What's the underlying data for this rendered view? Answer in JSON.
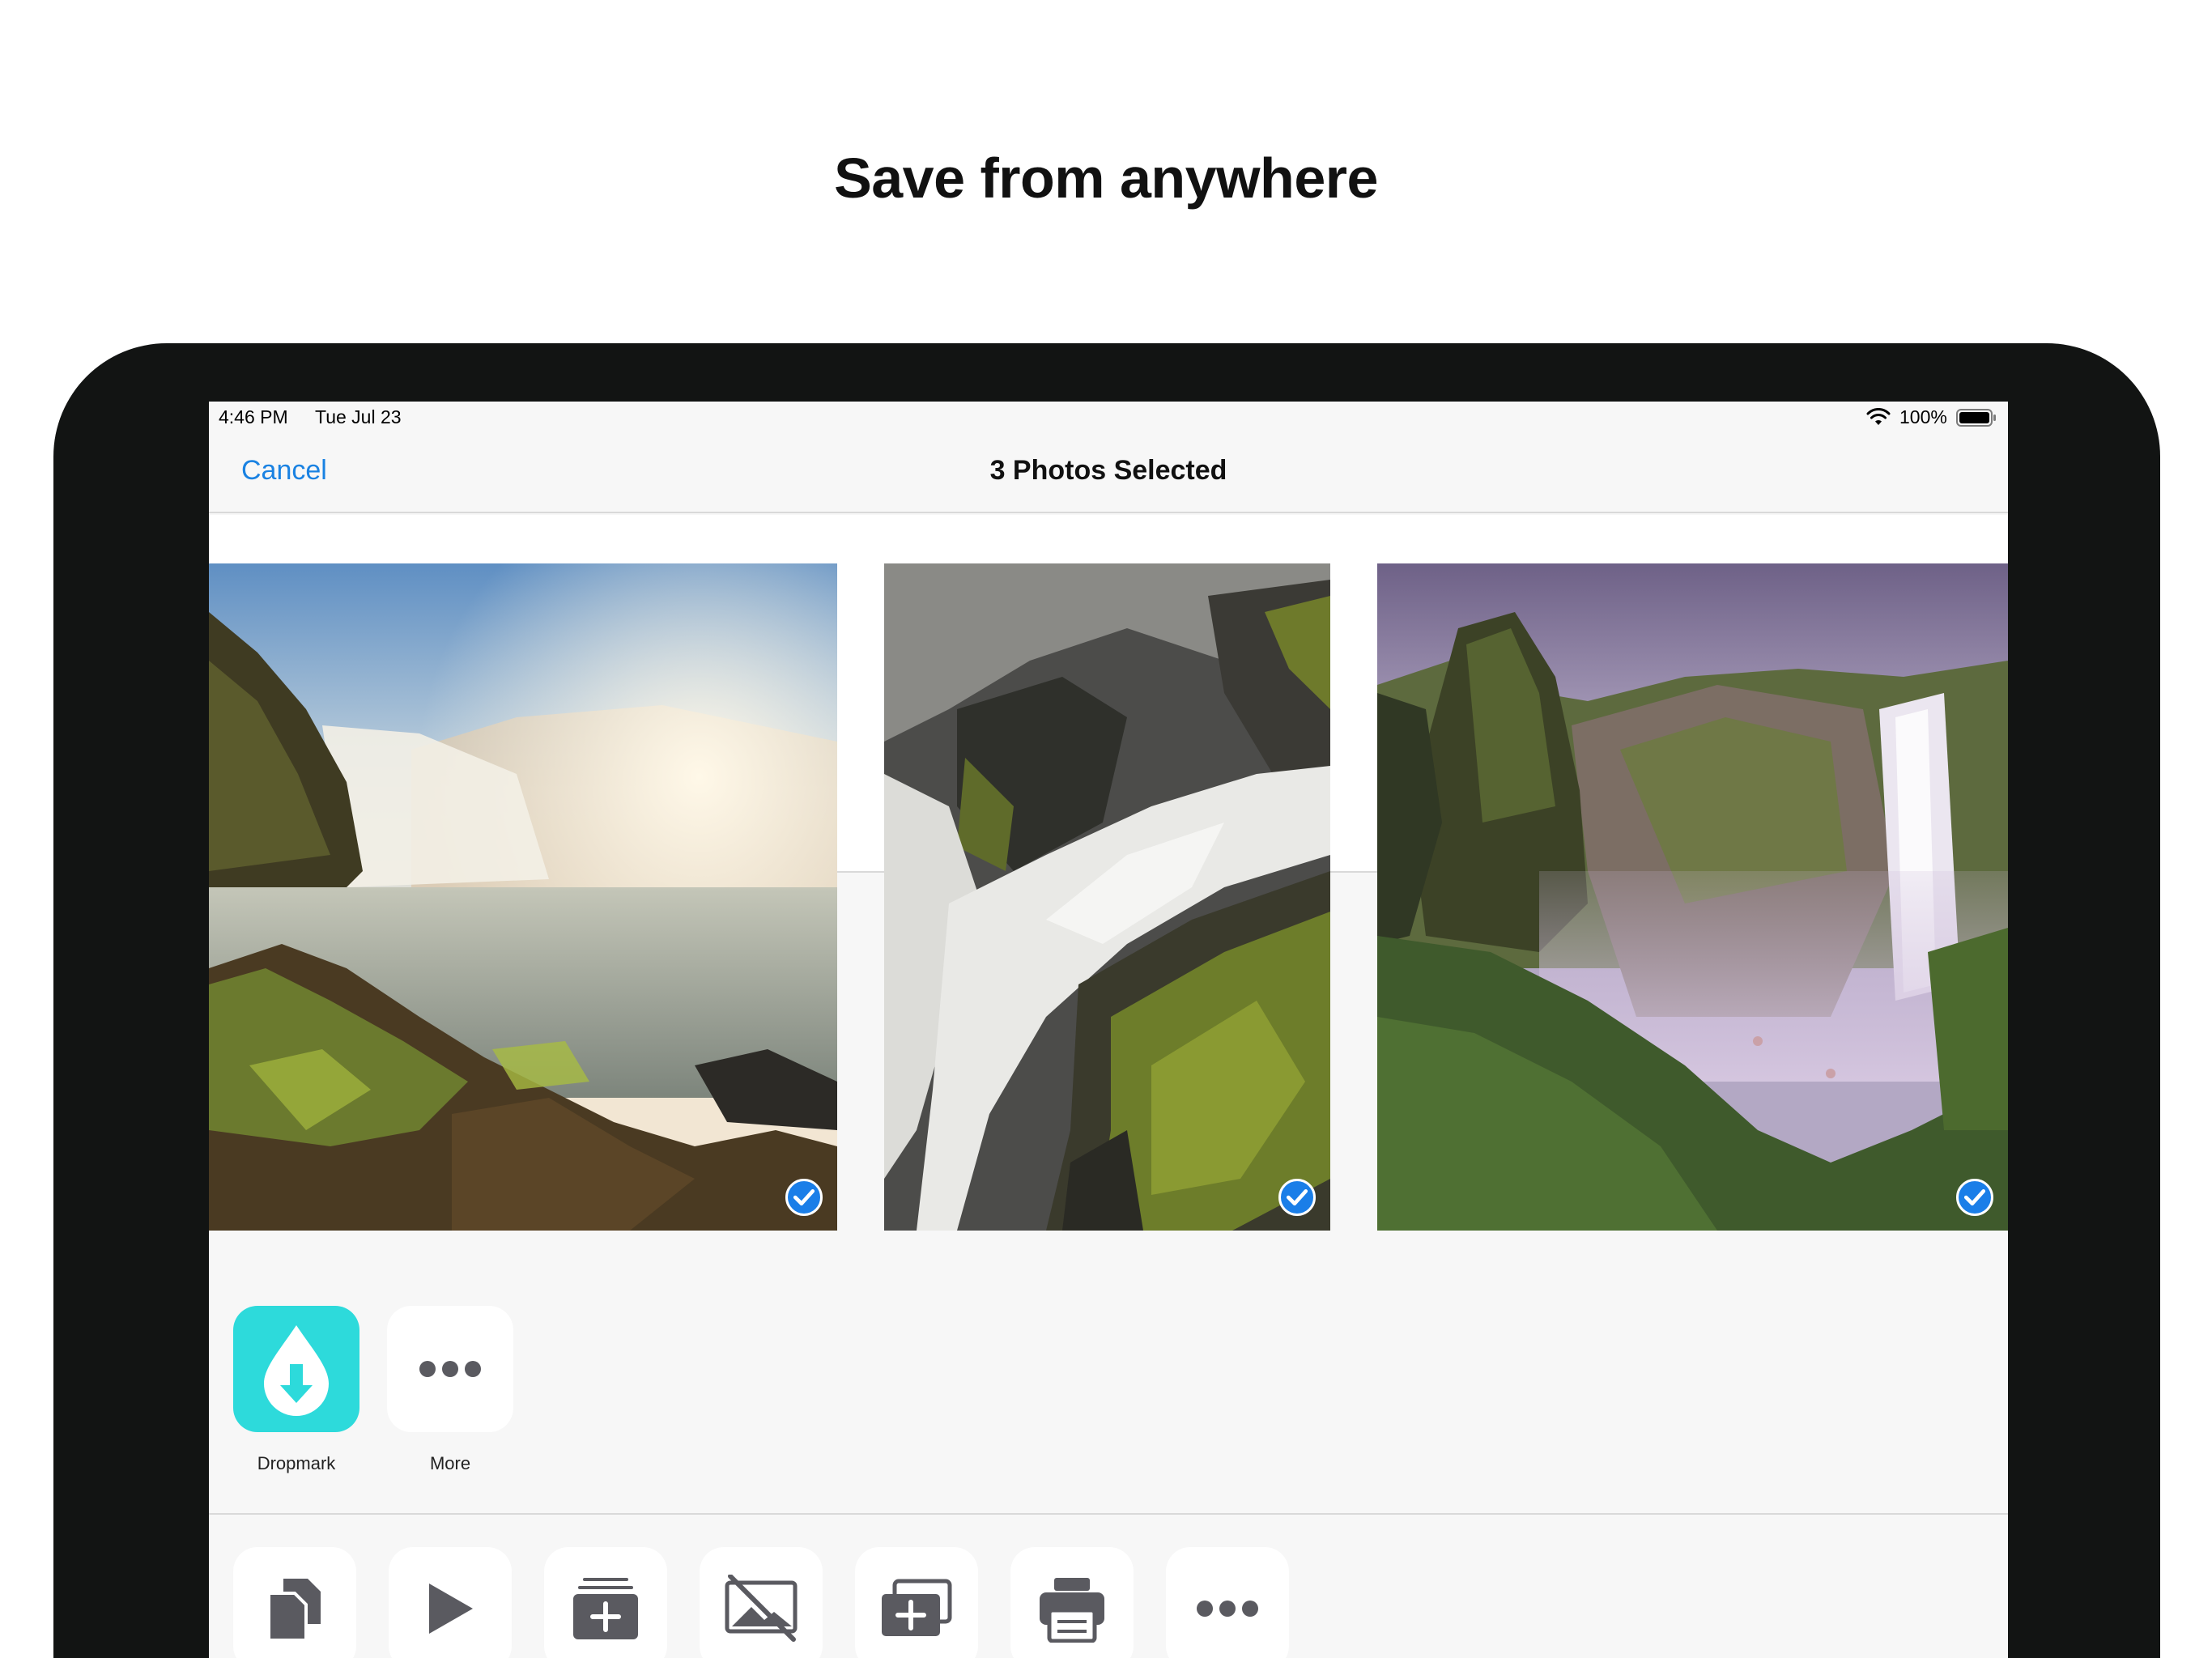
{
  "headline": "Save from anywhere",
  "status_bar": {
    "time": "4:46 PM",
    "date": "Tue Jul 23",
    "battery": "100%",
    "icons": [
      "wifi-icon",
      "battery-icon"
    ]
  },
  "nav": {
    "cancel_label": "Cancel",
    "title": "3 Photos Selected"
  },
  "photos": [
    {
      "subject": "waterfall-sunlit",
      "selected": true
    },
    {
      "subject": "waterfall-cascade",
      "selected": true
    },
    {
      "subject": "waterfall-misty-canyon",
      "selected": true
    }
  ],
  "apps": [
    {
      "label": "Dropmark",
      "icon": "dropmark-icon"
    },
    {
      "label": "More",
      "icon": "more-icon"
    }
  ],
  "actions": [
    {
      "icon": "copy-icon"
    },
    {
      "icon": "slideshow-icon"
    },
    {
      "icon": "add-to-album-icon"
    },
    {
      "icon": "hide-icon"
    },
    {
      "icon": "add-to-shared-album-icon"
    },
    {
      "icon": "print-icon"
    },
    {
      "icon": "more-icon"
    }
  ],
  "colors": {
    "accent": "#1a82e2",
    "dropmark": "#2ddadb",
    "check": "#1a7ee8",
    "frame": "#121413"
  }
}
